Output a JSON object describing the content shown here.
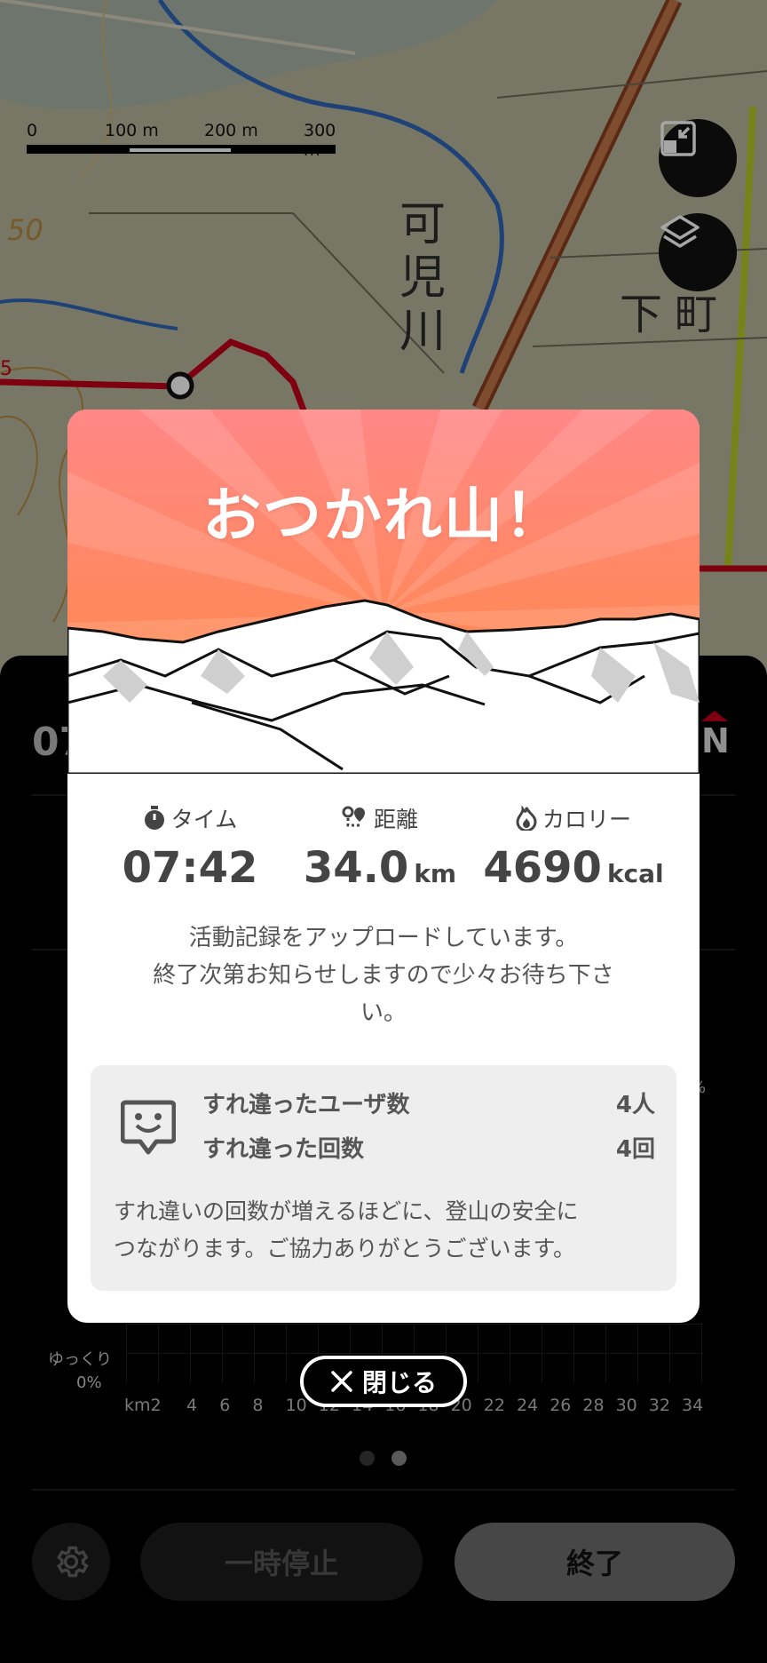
{
  "map": {
    "scale": {
      "labels": [
        "0",
        "100 m",
        "200 m",
        "300 m"
      ]
    },
    "place_labels": [
      "可",
      "児",
      "川",
      "下",
      "町",
      "50",
      "5"
    ],
    "colors": {
      "map_bg": "#b9b79c",
      "route": "#c2001a",
      "river": "#2f64b8"
    }
  },
  "sheet": {
    "time_partial": "07",
    "compass": "N",
    "percent_right": "%",
    "pace_label": "ゆっくり",
    "pace_percent": "0%",
    "x_ticks": [
      "km2",
      "4",
      "6",
      "8",
      "10",
      "12",
      "14",
      "16",
      "18",
      "20",
      "22",
      "24",
      "26",
      "28",
      "30",
      "32",
      "34"
    ],
    "pause_label": "一時停止",
    "end_label": "終了",
    "page_dots": 2,
    "active_dot": 1
  },
  "modal": {
    "title": "おつかれ山！",
    "stats": {
      "time": {
        "label": "タイム",
        "value": "07:42",
        "unit": ""
      },
      "distance": {
        "label": "距離",
        "value": "34.0",
        "unit": "km"
      },
      "calories": {
        "label": "カロリー",
        "value": "4690",
        "unit": "kcal"
      }
    },
    "upload_message_line1": "活動記録をアップロードしています。",
    "upload_message_line2": "終了次第お知らせしますので少々お待ち下さ",
    "upload_message_line3": "い。",
    "encounters": {
      "users_label": "すれ違ったユーザ数",
      "users_value": "4人",
      "count_label": "すれ違った回数",
      "count_value": "4回",
      "note_line1": "すれ違いの回数が増えるほどに、登山の安全に",
      "note_line2": "つながります。ご協力ありがとうございます。"
    },
    "colors": {
      "hero_top": "#ff8787",
      "hero_bottom": "#ff8a3c"
    }
  },
  "close_label": "閉じる"
}
